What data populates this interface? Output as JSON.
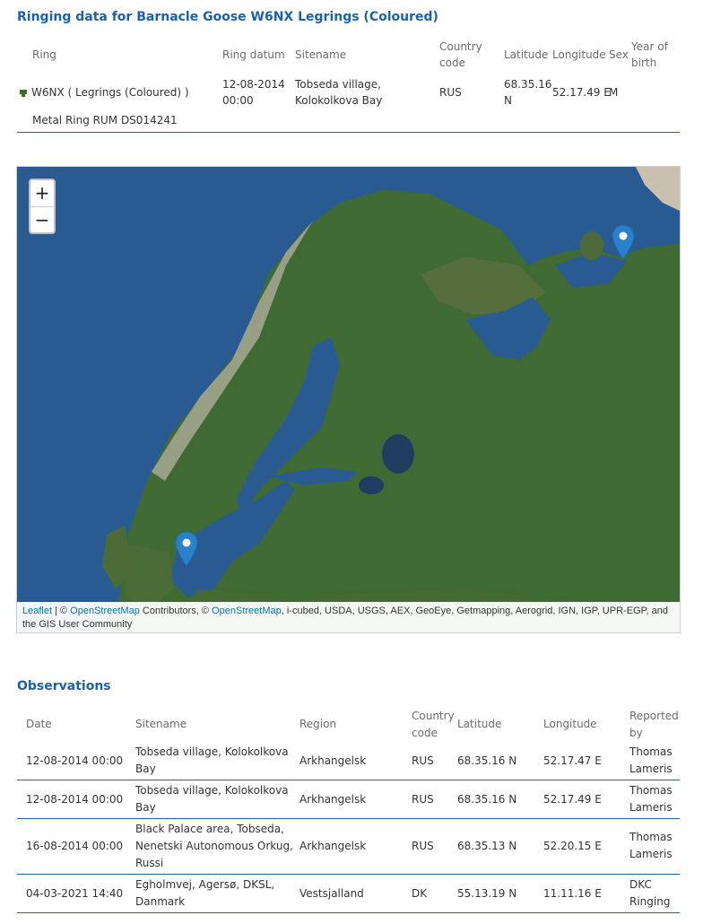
{
  "page": {
    "title": "Ringing data for Barnacle Goose W6NX Legrings (Coloured)"
  },
  "ringing": {
    "headers": {
      "ring": "Ring",
      "ring_datum": "Ring datum",
      "sitename": "Sitename",
      "country_code_1": "Country",
      "country_code_2": "code",
      "latitude": "Latitude",
      "longitude": "Longitude",
      "sex": "Sex",
      "yob_1": "Year of",
      "yob_2": "birth"
    },
    "row": {
      "ring": "W6NX ( Legrings (Coloured) )",
      "ring_datum_1": "12-08-2014",
      "ring_datum_2": "00:00",
      "sitename_1": "Tobseda village,",
      "sitename_2": "Kolokolkova Bay",
      "country_code": "RUS",
      "latitude_1": "68.35.16",
      "latitude_2": "N",
      "longitude": "52.17.49 E",
      "sex": "M",
      "year_of_birth": ""
    },
    "metal_ring": "Metal Ring RUM DS014241"
  },
  "map": {
    "zoom_in": "+",
    "zoom_out": "−",
    "attribution": {
      "leaflet": "Leaflet",
      "sep": " | © ",
      "osm1": "OpenStreetMap",
      "mid": " Contributors, © ",
      "osm2": "OpenStreetMap",
      "rest": ", i-cubed, USDA, USGS, AEX, GeoEye, Getmapping, Aerogrid, IGN, IGP, UPR-EGP, and the GIS User Community"
    },
    "marker_color": "#2a81cb"
  },
  "observations": {
    "title": "Observations",
    "headers": {
      "date": "Date",
      "sitename": "Sitename",
      "region": "Region",
      "country_code_1": "Country",
      "country_code_2": "code",
      "latitude": "Latitude",
      "longitude": "Longitude",
      "reported_1": "Reported",
      "reported_2": "by"
    },
    "rows": [
      {
        "date": "12-08-2014 00:00",
        "site_1": "Tobseda village, Kolokolkova",
        "site_2": "Bay",
        "site_3": "",
        "region": "Arkhangelsk",
        "cc": "RUS",
        "lat": "68.35.16 N",
        "lon": "52.17.47 E",
        "rep_1": "Thomas",
        "rep_2": "Lameris"
      },
      {
        "date": "12-08-2014 00:00",
        "site_1": "Tobseda village, Kolokolkova",
        "site_2": "Bay",
        "site_3": "",
        "region": "Arkhangelsk",
        "cc": "RUS",
        "lat": "68.35.16 N",
        "lon": "52.17.49 E",
        "rep_1": "Thomas",
        "rep_2": "Lameris"
      },
      {
        "date": "16-08-2014 00:00",
        "site_1": "Black Palace area, Tobseda,",
        "site_2": "Nenetski Autonomous Orkug,",
        "site_3": "Russi",
        "region": "Arkhangelsk",
        "cc": "RUS",
        "lat": "68.35.13 N",
        "lon": "52.20.15 E",
        "rep_1": "Thomas",
        "rep_2": "Lameris"
      },
      {
        "date": "04-03-2021 14:40",
        "site_1": "Egholmvej, Agersø, DKSL,",
        "site_2": "Danmark",
        "site_3": "",
        "region": "Vestsjalland",
        "cc": "DK",
        "lat": "55.13.19 N",
        "lon": "11.11.16 E",
        "rep_1": "DKC",
        "rep_2": "Ringing"
      }
    ]
  },
  "colors": {
    "accent": "#1b62a8",
    "link": "#0078a8"
  }
}
